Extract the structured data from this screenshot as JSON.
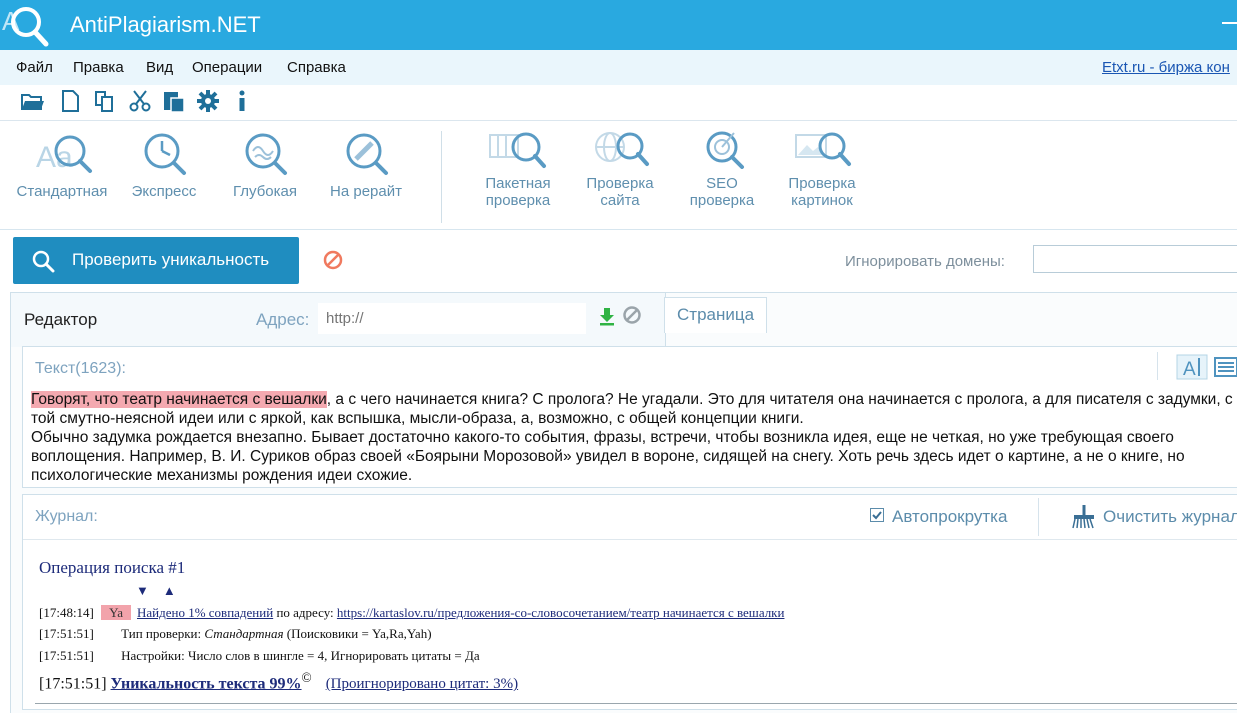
{
  "window": {
    "title": "AntiPlagiarism.NET"
  },
  "menu": {
    "items": [
      "Файл",
      "Правка",
      "Вид",
      "Операции",
      "Справка"
    ],
    "external_link": "Etxt.ru - биржа кон"
  },
  "toolbar": {
    "icons": [
      "open-folder-icon",
      "new-file-icon",
      "copy-icon",
      "cut-icon",
      "paste-icon",
      "settings-gear-icon",
      "info-icon"
    ]
  },
  "modes": {
    "standard": "Стандартная",
    "express": "Экспресс",
    "deep": "Глубокая",
    "rewrite": "На рерайт",
    "batch": "Пакетная проверка",
    "site": "Проверка сайта",
    "seo": "SEO проверка",
    "images": "Проверка картинок"
  },
  "actions": {
    "check_button": "Проверить уникальность",
    "ignore_domains_label": "Игнорировать домены:"
  },
  "editor": {
    "tab_editor": "Редактор",
    "address_label": "Адрес:",
    "address_placeholder": "http://",
    "tab_page": "Страница",
    "text_label": "Текст(1623):",
    "highlighted": "Говорят, что театр начинается с вешалки",
    "text_rest": ", а с чего начинается книга?  С пролога? Не угадали. Это для читателя она начинается с пролога, а для писателя с задумки, с той смутно-неясной идеи или с яркой, как вспышка, мысли-образа, а, возможно, с общей концепции книги.",
    "text_para2": "Обычно задумка рождается внезапно. Бывает достаточно какого-то события, фразы, встречи, чтобы возникла идея, еще не четкая, но уже требующая своего воплощения. Например, В. И. Суриков образ своей «Боярыни Морозовой» увидел в вороне, сидящей на снегу. Хоть речь здесь идет о картине, а не о книге, но психологические механизмы рождения идеи схожие."
  },
  "journal": {
    "label": "Журнал:",
    "autoscroll_label": "Автопрокрутка",
    "autoscroll_checked": true,
    "clear_label": "Очистить журнал",
    "operation_title": "Операция поиска #1",
    "arrow_down": "▼",
    "arrow_up": "▲",
    "log1": {
      "time": "[17:48:14]",
      "badge": "Ya",
      "link": "Найдено 1% совпадений",
      "middle": " по адресу: ",
      "url": "https://kartaslov.ru/предложения-со-словосочетанием/театр начинается с вешалки"
    },
    "log2": {
      "time": "[17:51:51]",
      "prefix": "Тип проверки: ",
      "type": "Стандартная",
      "suffix": " (Поисковики = Ya,Ra,Yah)"
    },
    "log3": {
      "time": "[17:51:51]",
      "text": "Настройки: Число слов в шингле = 4, Игнорировать цитаты = Да"
    },
    "result": {
      "time": "[17:51:51]",
      "uniqueness": "Уникальность текста 99%",
      "sup": "©",
      "ignored": "(Проигнорировано цитат: 3%)"
    }
  }
}
